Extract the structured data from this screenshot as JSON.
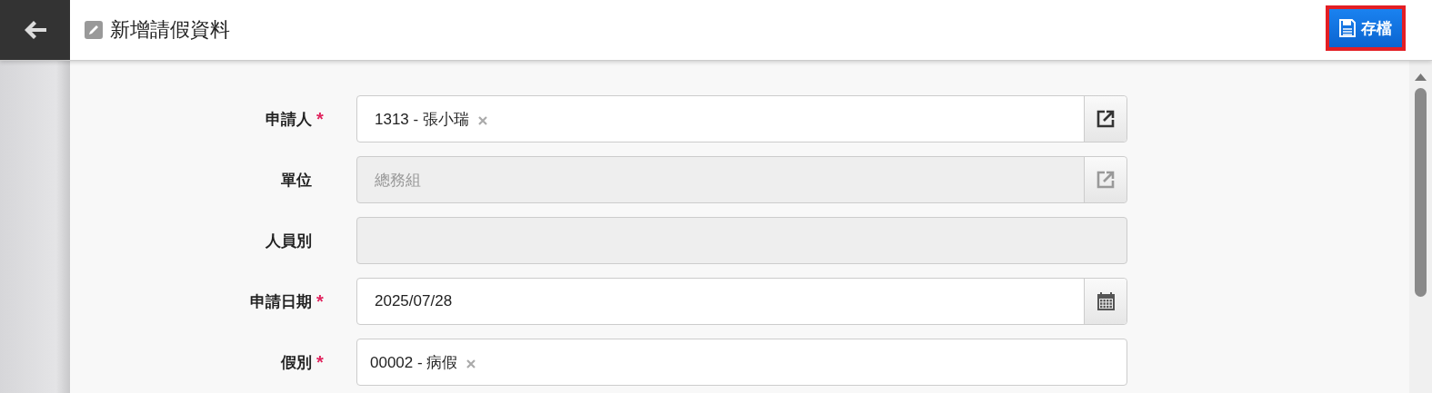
{
  "header": {
    "title": "新增請假資料",
    "save_button": "存檔"
  },
  "fields": [
    {
      "label": "申請人",
      "required_mark": "*",
      "kind": "lookup",
      "disabled": false,
      "value": "1313 - 張小瑞",
      "removable": true
    },
    {
      "label": "單位",
      "kind": "lookup",
      "disabled": true,
      "value": "總務組",
      "removable": false
    },
    {
      "label": "人員別",
      "kind": "plain",
      "disabled": true,
      "removable": false
    },
    {
      "label": "申請日期",
      "required_mark": "*",
      "kind": "date",
      "disabled": false,
      "value": "2025/07/28",
      "removable": false
    },
    {
      "label": "假別",
      "required_mark": "*",
      "kind": "plain",
      "disabled": false,
      "value": "00002 - 病假",
      "removable": true
    }
  ]
}
